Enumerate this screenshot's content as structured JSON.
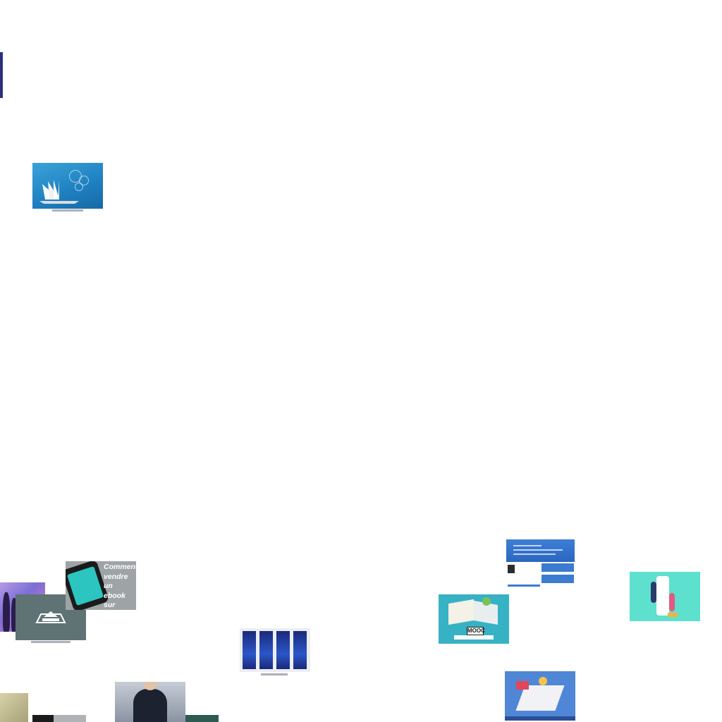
{
  "thumbnails": {
    "ebook_title": "Comment vendre un ebook sur internet ?",
    "mooc_badge": "MOOC"
  }
}
